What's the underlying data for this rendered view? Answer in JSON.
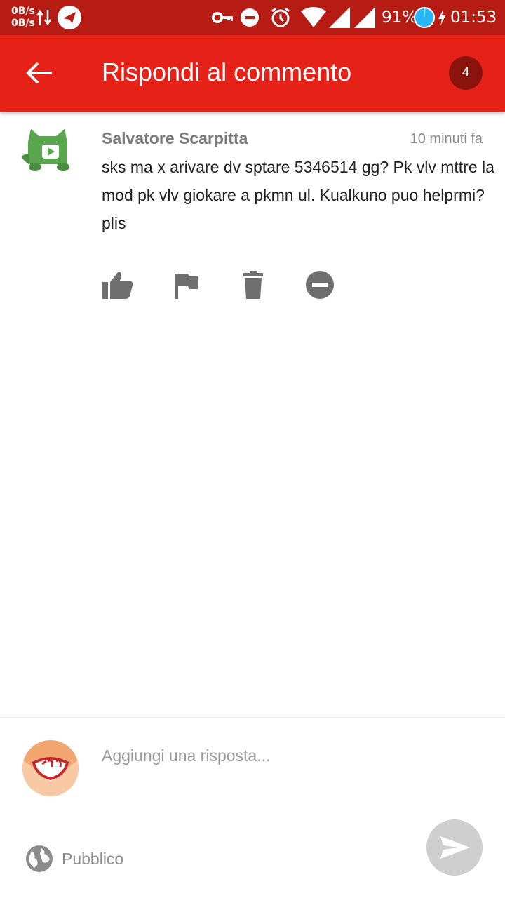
{
  "status_bar": {
    "net_up": "0B/s",
    "net_down": "0B/s",
    "battery": "91%",
    "time": "01:53"
  },
  "app_bar": {
    "title": "Rispondi al commento",
    "badge_count": "4"
  },
  "comment": {
    "author": "Salvatore Scarpitta",
    "time_ago": "10 minuti fa",
    "text": "sks ma x arivare dv sptare 5346514 gg? Pk vlv mttre la mod pk vlv giokare a pkmn ul. Kualkuno puo helprmi?plis",
    "actions": [
      "thumbs-up-icon",
      "flag-icon",
      "delete-icon",
      "block-icon"
    ]
  },
  "reply": {
    "placeholder": "Aggiungi una risposta...",
    "value": "",
    "visibility": "Pubblico"
  },
  "colors": {
    "status_bar": "#b71c14",
    "app_bar": "#e62117",
    "badge": "#8a130d",
    "send_button": "#cfcfcf"
  }
}
